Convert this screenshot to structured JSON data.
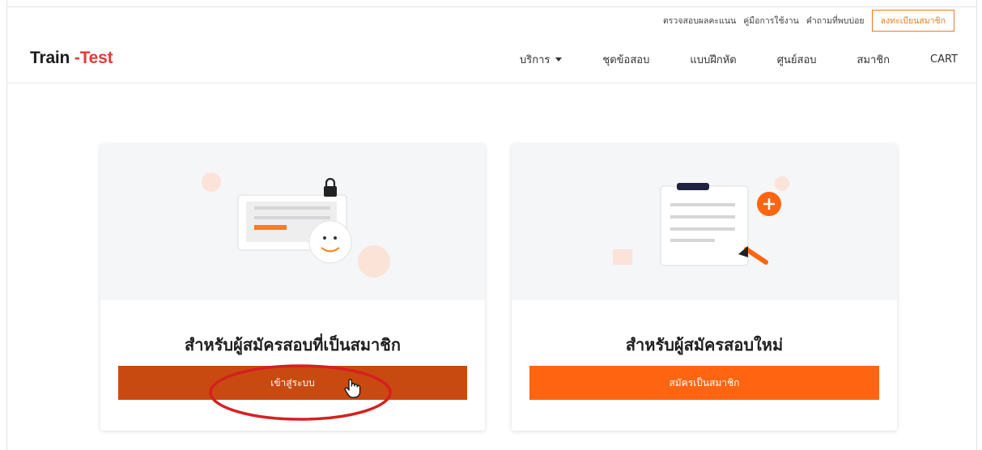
{
  "brand": {
    "part1": "Train",
    "part2": " -Test"
  },
  "topbar": {
    "links": [
      "ตรวจสอบผลคะแนน",
      "คู่มือการใช้งาน",
      "คำถามที่พบบ่อย"
    ],
    "register_label": "ลงทะเบียนสมาชิก"
  },
  "nav": {
    "items": [
      "บริการ",
      "ชุดข้อสอบ",
      "แบบฝึกหัด",
      "ศูนย์สอบ",
      "สมาชิก",
      "CART"
    ]
  },
  "cards": [
    {
      "title": "สำหรับผู้สมัครสอบที่เป็นสมาชิก",
      "button": "เข้าสู่ระบบ"
    },
    {
      "title": "สำหรับผู้สมัครสอบใหม่",
      "button": "สมัครเป็นสมาชิก"
    }
  ],
  "colors": {
    "accent": "#f07a22",
    "logo_red": "#e53935",
    "login_button": "#c94a10",
    "signup_button": "#ff6510",
    "annotation": "#d62020"
  }
}
